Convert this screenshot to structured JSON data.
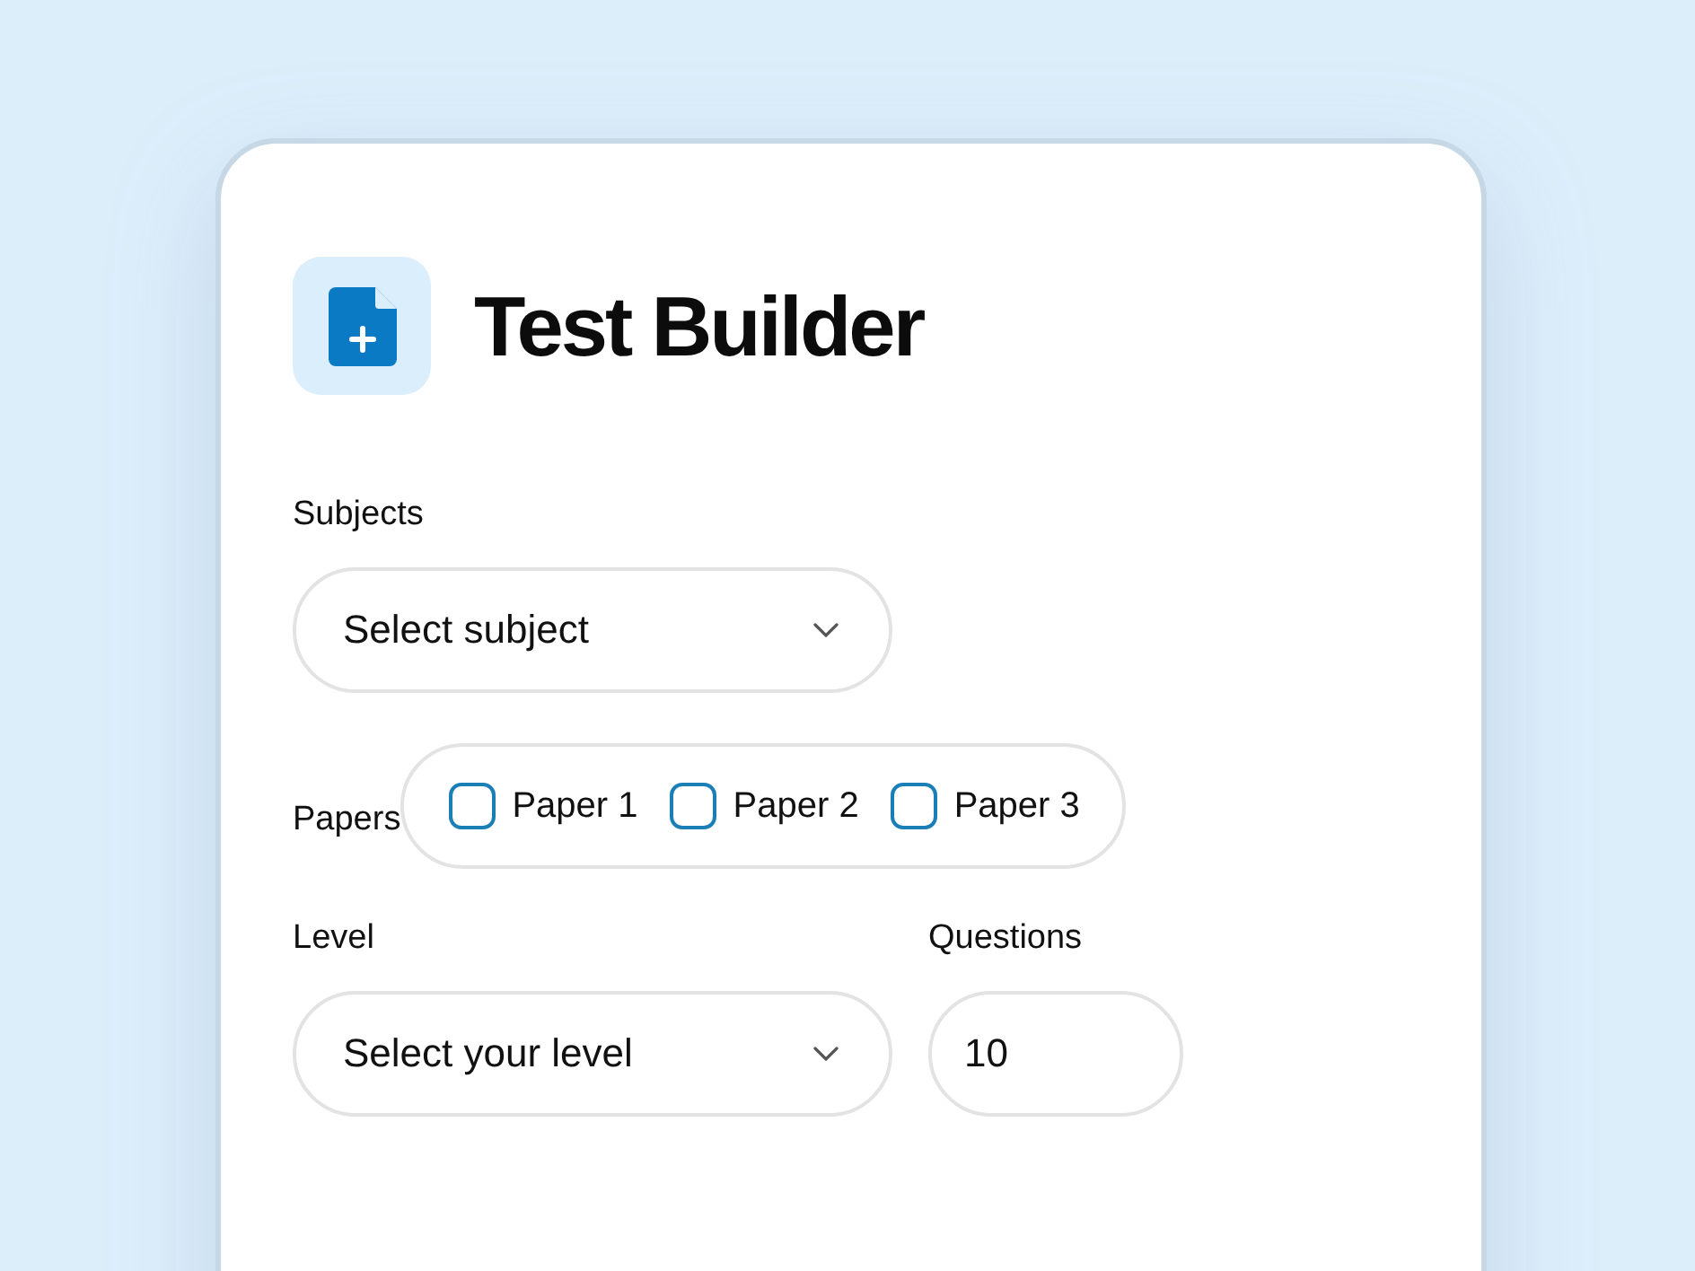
{
  "header": {
    "title": "Test Builder"
  },
  "subjects": {
    "label": "Subjects",
    "placeholder": "Select subject"
  },
  "papers": {
    "label": "Papers",
    "options": [
      {
        "label": "Paper 1",
        "checked": false
      },
      {
        "label": "Paper 2",
        "checked": false
      },
      {
        "label": "Paper 3",
        "checked": false
      }
    ]
  },
  "level": {
    "label": "Level",
    "placeholder": "Select your level"
  },
  "questions": {
    "label": "Questions",
    "value": "10"
  }
}
